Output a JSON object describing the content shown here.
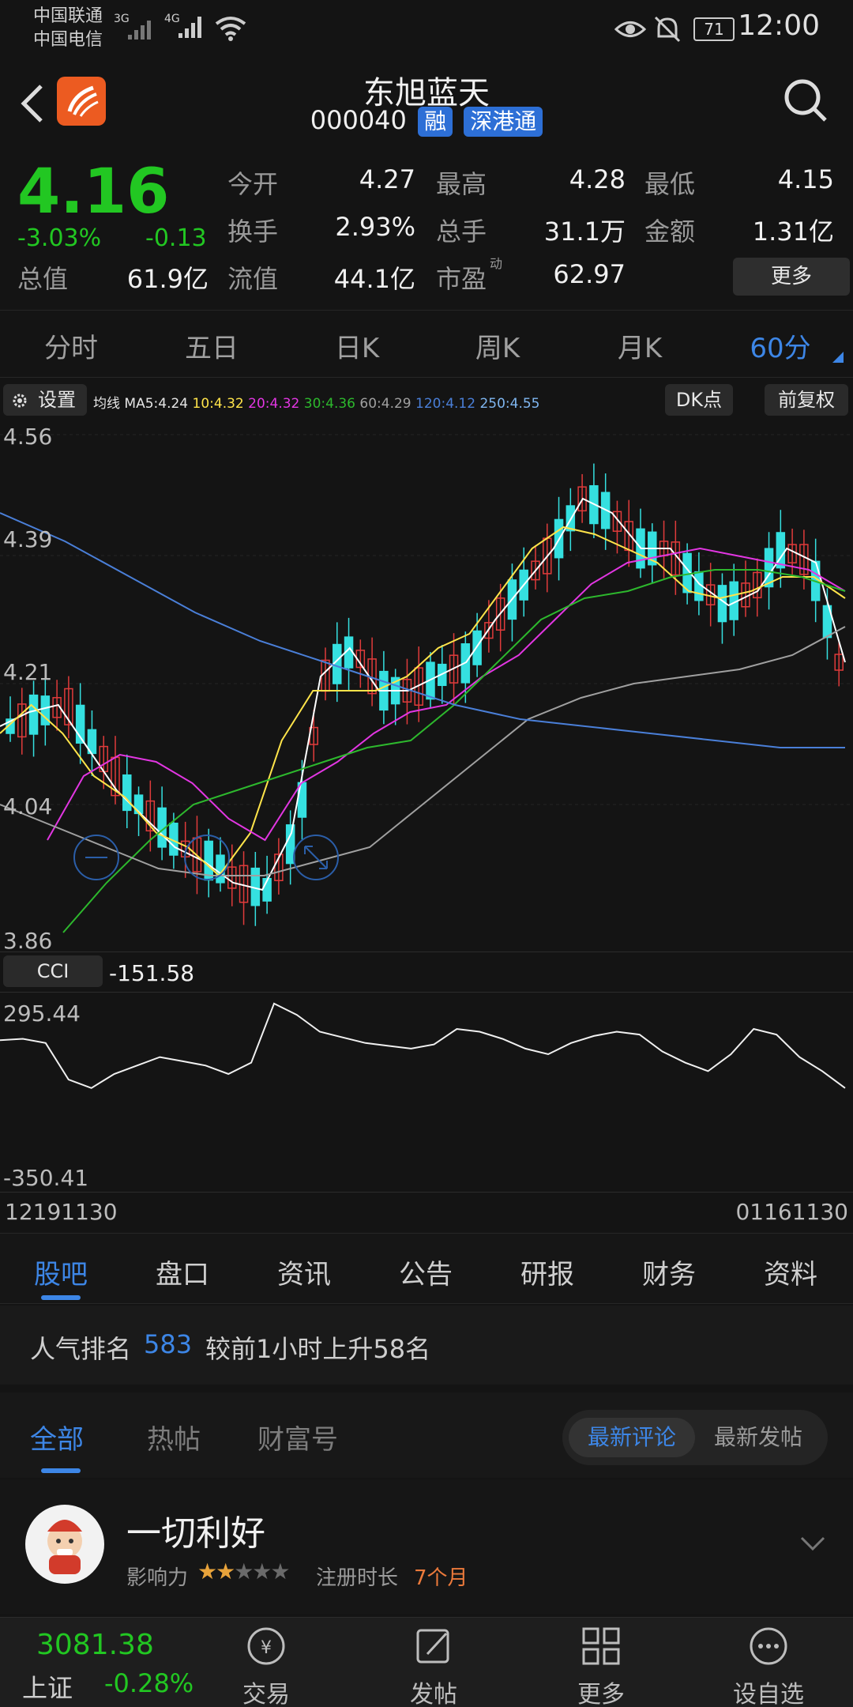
{
  "status": {
    "carrier1": "中国联通",
    "carrier2": "中国电信",
    "net1": "3G",
    "net2": "4G",
    "battery": "71",
    "time": "12:00"
  },
  "header": {
    "stock_name": "东旭蓝天",
    "code": "000040",
    "tag1": "融",
    "tag2": "深港通"
  },
  "quote": {
    "price": "4.16",
    "change_pct": "-3.03%",
    "change": "-0.13",
    "total_value_label": "总值",
    "total_value": "61.9亿",
    "fields": [
      {
        "label": "今开",
        "value": "4.27"
      },
      {
        "label": "最高",
        "value": "4.28"
      },
      {
        "label": "最低",
        "value": "4.15"
      },
      {
        "label": "换手",
        "value": "2.93%"
      },
      {
        "label": "总手",
        "value": "31.1万"
      },
      {
        "label": "金额",
        "value": "1.31亿"
      },
      {
        "label": "流值",
        "value": "44.1亿"
      },
      {
        "label": "市盈",
        "value": "62.97"
      }
    ],
    "pe_sup": "动",
    "more_label": "更多",
    "colors": {
      "down": "#22c722",
      "up": "#e03b3b"
    }
  },
  "periods": [
    "分时",
    "五日",
    "日K",
    "周K",
    "月K",
    "60分"
  ],
  "chart_toolbar": {
    "settings": "设置",
    "ma_title": "均线",
    "ma5": "MA5:4.24",
    "ma10": "10:4.32",
    "ma20": "20:4.32",
    "ma30": "30:4.36",
    "ma60": "60:4.29",
    "ma120": "120:4.12",
    "ma250": "250:4.55",
    "dk": "DK点",
    "adjust": "前复权"
  },
  "price_axis": [
    "4.56",
    "4.39",
    "4.21",
    "4.04",
    "3.86"
  ],
  "cci": {
    "label": "CCI",
    "value": "-151.58",
    "max": "295.44",
    "min": "-350.41"
  },
  "dates": {
    "start": "12191130",
    "end": "01161130"
  },
  "chart_data": {
    "type": "line",
    "title": "",
    "xlabel": "",
    "ylabel": "",
    "ylim": [
      3.86,
      4.56
    ],
    "series": [
      {
        "name": "MA5",
        "color": "#ffffff",
        "values": [
          4.15,
          4.17,
          4.18,
          4.12,
          4.06,
          4.02,
          3.98,
          3.96,
          3.93,
          3.92,
          4.0,
          4.22,
          4.26,
          4.2,
          4.2,
          4.22,
          4.24,
          4.3,
          4.35,
          4.4,
          4.47,
          4.45,
          4.4,
          4.4,
          4.35,
          4.32,
          4.34,
          4.4,
          4.38,
          4.24
        ]
      },
      {
        "name": "10",
        "color": "#ffe44a",
        "values": [
          4.14,
          4.18,
          4.14,
          4.08,
          4.05,
          4.0,
          3.98,
          3.94,
          4.0,
          4.13,
          4.2,
          4.2,
          4.2,
          4.22,
          4.26,
          4.28,
          4.34,
          4.4,
          4.43,
          4.42,
          4.4,
          4.38,
          4.34,
          4.33,
          4.34,
          4.36,
          4.36,
          4.33
        ]
      },
      {
        "name": "20",
        "color": "#e236e2",
        "values": [
          3.99,
          4.08,
          4.11,
          4.1,
          4.07,
          4.02,
          3.99,
          4.07,
          4.1,
          4.14,
          4.17,
          4.18,
          4.22,
          4.25,
          4.3,
          4.35,
          4.38,
          4.39,
          4.4,
          4.39,
          4.38,
          4.37,
          4.34
        ]
      },
      {
        "name": "30",
        "color": "#2db82d",
        "values": [
          3.86,
          3.93,
          3.99,
          4.04,
          4.06,
          4.08,
          4.1,
          4.12,
          4.13,
          4.18,
          4.24,
          4.3,
          4.33,
          4.34,
          4.36,
          4.37,
          4.37,
          4.36,
          4.34
        ]
      },
      {
        "name": "60",
        "color": "#a0a0a0",
        "values": [
          4.04,
          4.01,
          3.98,
          3.95,
          3.94,
          3.94,
          3.96,
          3.98,
          4.04,
          4.1,
          4.16,
          4.19,
          4.21,
          4.22,
          4.23,
          4.25,
          4.29
        ]
      },
      {
        "name": "120",
        "color": "#4a7fd8",
        "values": [
          4.45,
          4.41,
          4.36,
          4.31,
          4.27,
          4.24,
          4.21,
          4.18,
          4.16,
          4.15,
          4.14,
          4.13,
          4.12,
          4.12
        ]
      }
    ],
    "cci_values": [
      160,
      165,
      150,
      20,
      -10,
      40,
      70,
      100,
      85,
      70,
      40,
      80,
      290,
      250,
      190,
      170,
      150,
      140,
      130,
      145,
      200,
      190,
      165,
      130,
      110,
      150,
      175,
      190,
      180,
      120,
      80,
      50,
      110,
      200,
      180,
      100,
      50,
      -10
    ]
  },
  "info_tabs": [
    "股吧",
    "盘口",
    "资讯",
    "公告",
    "研报",
    "财务",
    "资料"
  ],
  "rank": {
    "prefix": "人气排名",
    "number": "583",
    "suffix": "较前1小时上升58名"
  },
  "sub_tabs": {
    "all": "全部",
    "hot": "热帖",
    "wealth": "财富号",
    "latest_comment": "最新评论",
    "latest_post": "最新发帖"
  },
  "post": {
    "name": "一切利好",
    "influence_label": "影响力",
    "stars": "★★★★★",
    "stars_filled": 2,
    "reg_label": "注册时长",
    "reg_value": "7个月"
  },
  "index": {
    "value": "3081.38",
    "name": "上证",
    "change": "-0.28%"
  },
  "nav": [
    "交易",
    "发帖",
    "更多",
    "设自选"
  ]
}
